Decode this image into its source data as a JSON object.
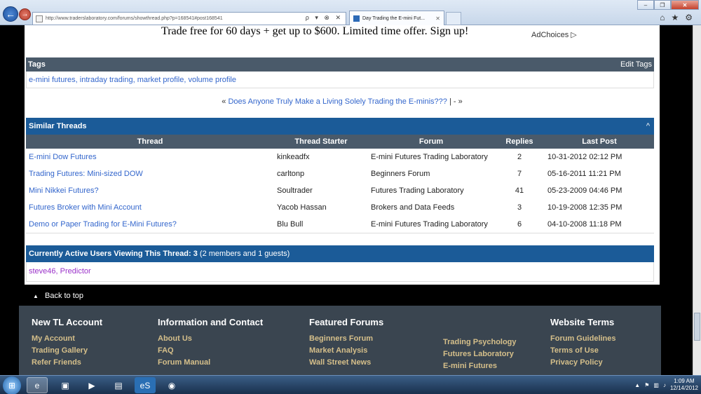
{
  "browser": {
    "url": "http://www.traderslaboratory.com/forums/showthread.php?p=168541#post168541",
    "tab_title": "Day Trading the E-mini Fut...",
    "addr_controls": "ρ ▾ ⊗ ✕"
  },
  "ad": {
    "text": "Trade free for 60 days + get up to $600. Limited time offer. Sign up!",
    "adchoices": "AdChoices ▷"
  },
  "tags": {
    "header": "Tags",
    "edit": "Edit Tags",
    "list": [
      "e-mini futures",
      "intraday trading",
      "market profile",
      "volume profile"
    ]
  },
  "thread_nav": {
    "prev": "«",
    "title": "Does Anyone Truly Make a Living Solely Trading the E-minis???",
    "sep": "| -",
    "next": "»"
  },
  "similar": {
    "header": "Similar Threads",
    "columns": [
      "Thread",
      "Thread Starter",
      "Forum",
      "Replies",
      "Last Post"
    ],
    "rows": [
      {
        "thread": "E-mini Dow Futures",
        "starter": "kinkeadfx",
        "forum": "E-mini Futures Trading Laboratory",
        "replies": "2",
        "last": "10-31-2012 02:12 PM"
      },
      {
        "thread": "Trading Futures: Mini-sized DOW",
        "starter": "carltonp",
        "forum": "Beginners Forum",
        "replies": "7",
        "last": "05-16-2011 11:21 PM"
      },
      {
        "thread": "Mini Nikkei Futures?",
        "starter": "Soultrader",
        "forum": "Futures Trading Laboratory",
        "replies": "41",
        "last": "05-23-2009 04:46 PM"
      },
      {
        "thread": "Futures Broker with Mini Account",
        "starter": "Yacob Hassan",
        "forum": "Brokers and Data Feeds",
        "replies": "3",
        "last": "10-19-2008 12:35 PM"
      },
      {
        "thread": "Demo or Paper Trading for E-Mini Futures?",
        "starter": "Blu Bull",
        "forum": "E-mini Futures Trading Laboratory",
        "replies": "6",
        "last": "04-10-2008 11:18 PM"
      }
    ]
  },
  "active": {
    "label": "Currently Active Users Viewing This Thread: 3",
    "detail": "(2 members and 1 guests)",
    "users": "steve46, Predictor"
  },
  "back_to_top": "Back to top",
  "footer": {
    "new_account": {
      "title": "New TL Account",
      "items": [
        "My Account",
        "Trading Gallery",
        "Refer Friends"
      ]
    },
    "info": {
      "title": "Information and Contact",
      "items": [
        "About Us",
        "FAQ",
        "Forum Manual"
      ]
    },
    "featured": {
      "title": "Featured Forums",
      "col1": [
        "Beginners Forum",
        "Market Analysis",
        "Wall Street News"
      ],
      "col2": [
        "Trading Psychology",
        "Futures Laboratory",
        "E-mini Futures"
      ]
    },
    "terms": {
      "title": "Website Terms",
      "items": [
        "Forum Guidelines",
        "Terms of Use",
        "Privacy Policy"
      ]
    }
  },
  "taskbar": {
    "time": "1:09 AM",
    "date": "12/14/2012"
  }
}
